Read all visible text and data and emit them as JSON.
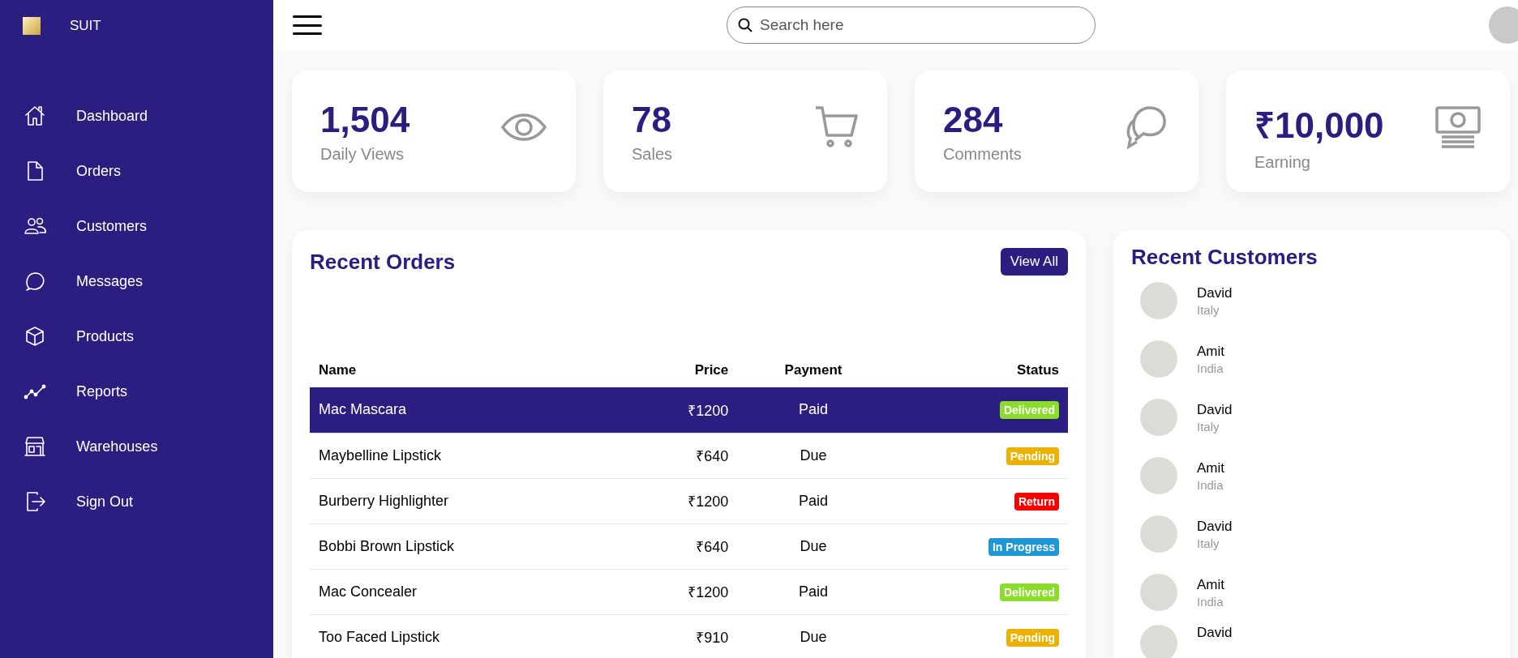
{
  "sidebar": {
    "brand": "SUIT",
    "items": [
      {
        "label": "Dashboard",
        "kind": "home"
      },
      {
        "label": "Orders",
        "kind": "file"
      },
      {
        "label": "Customers",
        "kind": "people"
      },
      {
        "label": "Messages",
        "kind": "chat"
      },
      {
        "label": "Products",
        "kind": "cube"
      },
      {
        "label": "Reports",
        "kind": "chart"
      },
      {
        "label": "Warehouses",
        "kind": "store"
      },
      {
        "label": "Sign Out",
        "kind": "signout"
      }
    ]
  },
  "topbar": {
    "search": {
      "placeholder": "Search here"
    }
  },
  "cards": [
    {
      "value": "1,504",
      "label": "Daily Views",
      "kind": "eye"
    },
    {
      "value": "78",
      "label": "Sales",
      "kind": "cart"
    },
    {
      "value": "284",
      "label": "Comments",
      "kind": "chat"
    },
    {
      "value": "₹10,000",
      "label": "Earning",
      "kind": "money"
    }
  ],
  "recent_orders": {
    "title": "Recent Orders",
    "button": "View All",
    "columns": [
      "Name",
      "Price",
      "Payment",
      "Status"
    ],
    "rows": [
      {
        "name": "Mac Mascara",
        "price": "₹1200",
        "payment": "Paid",
        "status": "Delivered",
        "color": "#8cdc2a",
        "selected": true
      },
      {
        "name": "Maybelline Lipstick",
        "price": "₹640",
        "payment": "Due",
        "status": "Pending",
        "color": "#eeb100",
        "selected": false
      },
      {
        "name": "Burberry Highlighter",
        "price": "₹1200",
        "payment": "Paid",
        "status": "Return",
        "color": "#ff0000",
        "selected": false
      },
      {
        "name": "Bobbi Brown Lipstick",
        "price": "₹640",
        "payment": "Due",
        "status": "In Progress",
        "color": "#1d97d5",
        "selected": false
      },
      {
        "name": "Mac Concealer",
        "price": "₹1200",
        "payment": "Paid",
        "status": "Delivered",
        "color": "#8cdc2a",
        "selected": false
      },
      {
        "name": "Too Faced Lipstick",
        "price": "₹910",
        "payment": "Due",
        "status": "Pending",
        "color": "#eeb100",
        "selected": false
      }
    ]
  },
  "recent_customers": {
    "title": "Recent Customers",
    "customers": [
      {
        "name": "David",
        "country": "Italy"
      },
      {
        "name": "Amit",
        "country": "India"
      },
      {
        "name": "David",
        "country": "Italy"
      },
      {
        "name": "Amit",
        "country": "India"
      },
      {
        "name": "David",
        "country": "Italy"
      },
      {
        "name": "Amit",
        "country": "India"
      },
      {
        "name": "David"
      }
    ]
  }
}
